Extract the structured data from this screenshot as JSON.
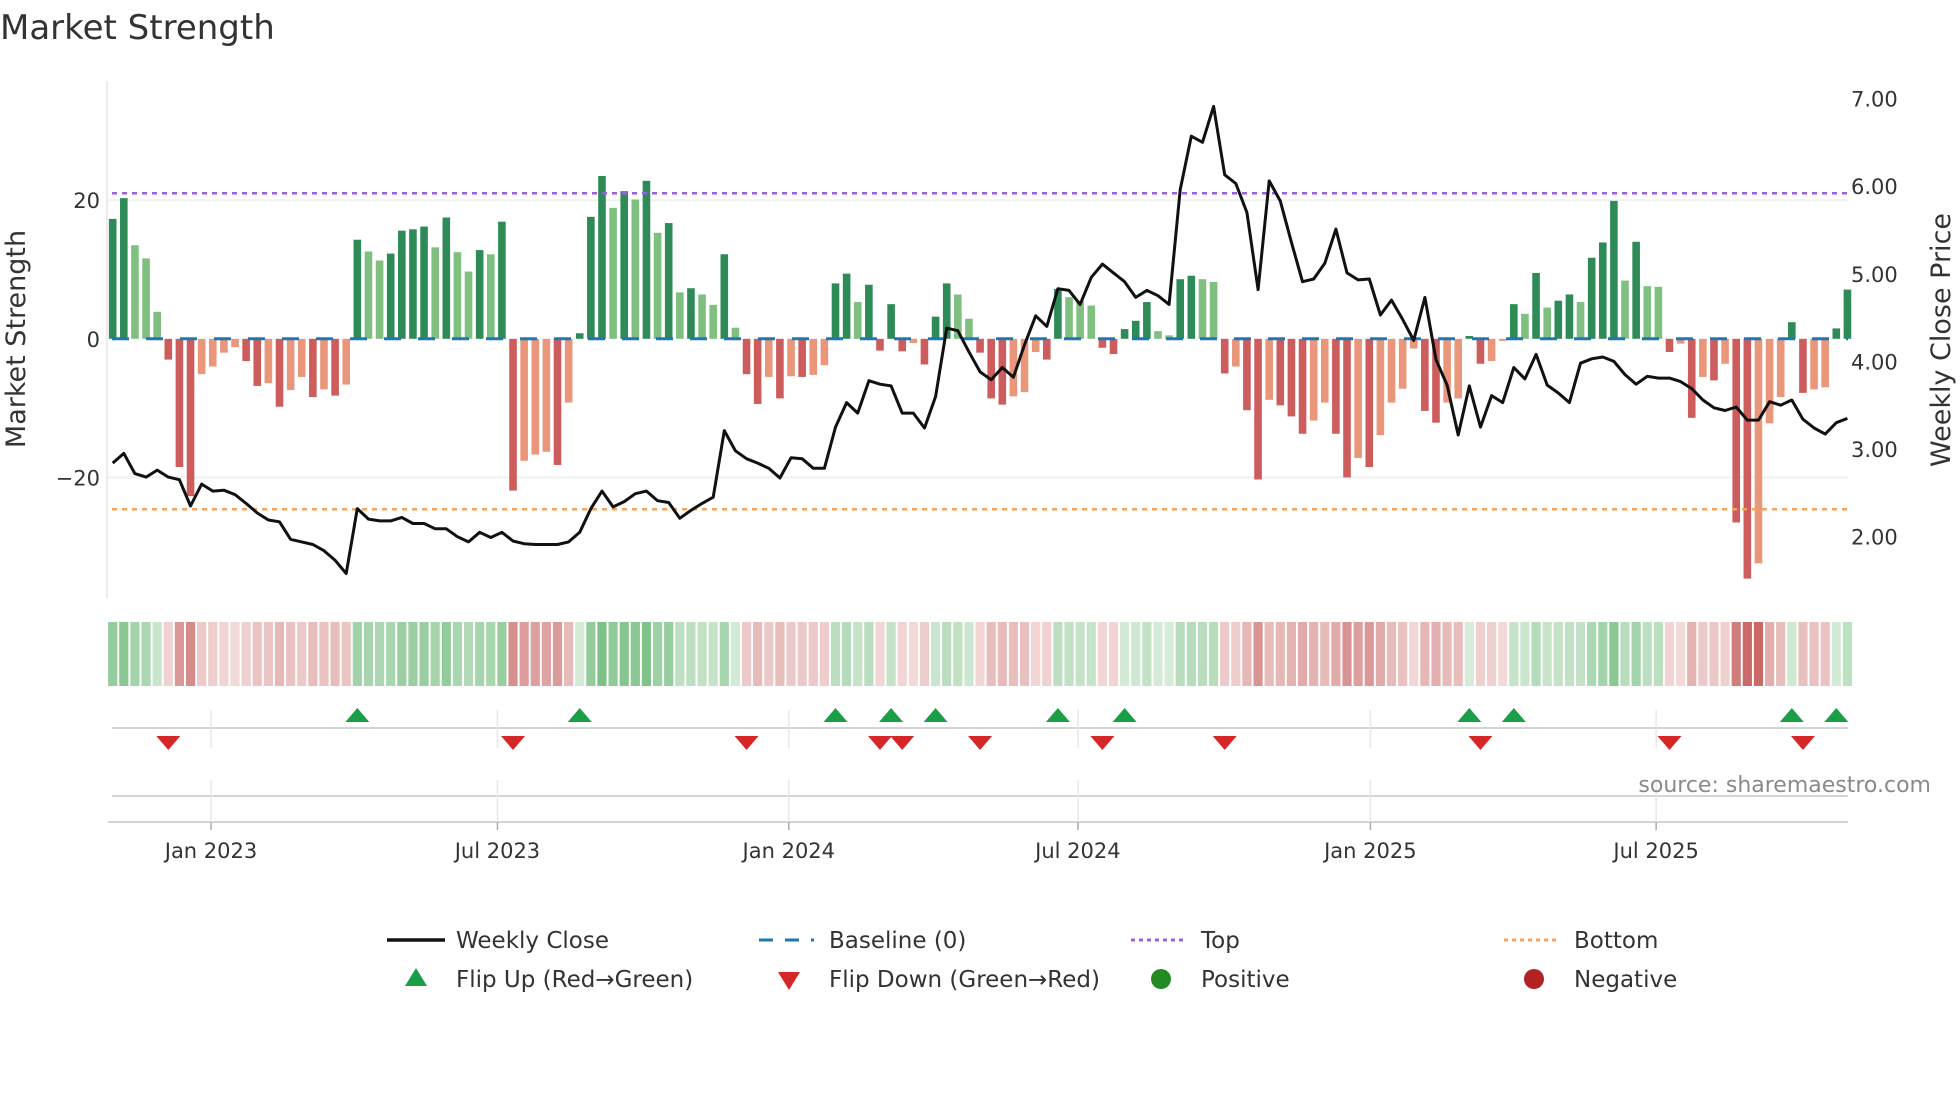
{
  "title": "Market Strength",
  "source": "source: sharemaestro.com",
  "colors": {
    "pos_dark": "#2e8b57",
    "pos_light": "#7fbf7f",
    "neg_dark": "#cd5c5c",
    "neg_light": "#e9967a",
    "baseline": "#1f77b4",
    "top": "#9b5fe0",
    "bottom": "#f4a460",
    "close": "#111111",
    "flip_up": "#1a9e47",
    "flip_down": "#d62728",
    "positive": "#228b22",
    "negative": "#b22222"
  },
  "legend": {
    "weekly_close": "Weekly Close",
    "baseline": "Baseline (0)",
    "top": "Top",
    "bottom": "Bottom",
    "flip_up": "Flip Up (Red→Green)",
    "flip_down": "Flip Down (Green→Red)",
    "positive": "Positive",
    "negative": "Negative"
  },
  "chart_data": {
    "type": "bar",
    "title": "Market Strength",
    "ylabel": "Market Strength",
    "y2label": "Weekly Close Price",
    "ylim": [
      -37.4,
      37.2
    ],
    "y2lim": [
      1.3,
      7.2
    ],
    "yticks": [
      {
        "v": 20,
        "label": "20"
      },
      {
        "v": 0,
        "label": "0"
      },
      {
        "v": -20,
        "label": "−20"
      }
    ],
    "y2ticks": [
      {
        "v": 7,
        "label": "7.00"
      },
      {
        "v": 6,
        "label": "6.00"
      },
      {
        "v": 5,
        "label": "5.00"
      },
      {
        "v": 4,
        "label": "4.00"
      },
      {
        "v": 3,
        "label": "3.00"
      },
      {
        "v": 2,
        "label": "2.00"
      }
    ],
    "xticks": [
      {
        "week": 9.84,
        "label": "Jan 2023"
      },
      {
        "week": 35.6,
        "label": "Jul 2023"
      },
      {
        "week": 61.8,
        "label": "Jan 2024"
      },
      {
        "week": 87.8,
        "label": "Jul 2024"
      },
      {
        "week": 114.1,
        "label": "Jan 2025"
      },
      {
        "week": 139.8,
        "label": "Jul 2025"
      }
    ],
    "top_level": 21.0,
    "bottom_level": -24.6,
    "baseline": 0,
    "strength": [
      17.3,
      20.3,
      13.5,
      11.6,
      3.9,
      -3.0,
      -18.5,
      -22.7,
      -5.1,
      -4.0,
      -2.0,
      -1.2,
      -3.2,
      -6.8,
      -6.4,
      -9.8,
      -7.4,
      -5.5,
      -8.4,
      -7.3,
      -8.2,
      -6.6,
      14.3,
      12.6,
      11.3,
      12.3,
      15.6,
      15.8,
      16.2,
      13.2,
      17.5,
      12.5,
      9.7,
      12.8,
      12.2,
      16.9,
      -21.9,
      -17.6,
      -16.7,
      -16.3,
      -18.2,
      -9.2,
      0.8,
      17.6,
      23.5,
      18.9,
      21.3,
      20.1,
      22.8,
      15.3,
      16.7,
      6.7,
      7.3,
      6.4,
      4.9,
      12.2,
      1.6,
      -5.1,
      -9.4,
      -5.5,
      -8.6,
      -5.4,
      -5.5,
      -5.2,
      -3.8,
      8.0,
      9.4,
      5.3,
      7.8,
      -1.7,
      5.0,
      -1.8,
      -0.6,
      -3.7,
      3.2,
      8.0,
      6.4,
      2.9,
      -2.0,
      -8.6,
      -9.5,
      -8.3,
      -7.7,
      -1.9,
      -3.0,
      7.2,
      6.0,
      5.5,
      4.8,
      -1.3,
      -2.2,
      1.4,
      2.6,
      5.3,
      1.1,
      0.5,
      8.6,
      9.1,
      8.6,
      8.2,
      -5.0,
      -4.0,
      -10.3,
      -20.3,
      -8.8,
      -9.6,
      -11.2,
      -13.7,
      -11.8,
      -9.2,
      -13.7,
      -20.0,
      -17.2,
      -18.5,
      -13.9,
      -9.2,
      -7.2,
      -1.4,
      -10.4,
      -12.1,
      -9.2,
      -8.6,
      0.4,
      -3.6,
      -3.2,
      -0.3,
      5.0,
      3.6,
      9.5,
      4.5,
      5.5,
      6.4,
      5.3,
      11.7,
      13.9,
      19.9,
      8.4,
      14.0,
      7.6,
      7.5,
      -1.9,
      -0.7,
      -11.4,
      -5.5,
      -6.0,
      -3.6,
      -26.5,
      -34.6,
      -32.4,
      -12.2,
      -8.4,
      2.4,
      -7.8,
      -7.3,
      -7.0,
      1.5,
      7.1
    ],
    "close": [
      2.84,
      2.95,
      2.72,
      2.68,
      2.76,
      2.68,
      2.65,
      2.35,
      2.6,
      2.52,
      2.53,
      2.48,
      2.38,
      2.27,
      2.19,
      2.17,
      1.97,
      1.94,
      1.91,
      1.84,
      1.73,
      1.58,
      2.32,
      2.2,
      2.18,
      2.18,
      2.22,
      2.15,
      2.15,
      2.09,
      2.09,
      2.0,
      1.94,
      2.05,
      1.99,
      2.05,
      1.95,
      1.92,
      1.91,
      1.91,
      1.91,
      1.94,
      2.05,
      2.32,
      2.52,
      2.34,
      2.4,
      2.49,
      2.52,
      2.41,
      2.39,
      2.21,
      2.3,
      2.38,
      2.45,
      3.21,
      2.98,
      2.89,
      2.84,
      2.78,
      2.67,
      2.9,
      2.89,
      2.78,
      2.78,
      3.25,
      3.53,
      3.41,
      3.78,
      3.74,
      3.72,
      3.41,
      3.41,
      3.24,
      3.6,
      4.38,
      4.35,
      4.11,
      3.88,
      3.79,
      3.93,
      3.82,
      4.19,
      4.52,
      4.4,
      4.83,
      4.81,
      4.65,
      4.96,
      5.11,
      5.01,
      4.91,
      4.73,
      4.81,
      4.75,
      4.65,
      5.96,
      6.57,
      6.5,
      6.91,
      6.13,
      6.03,
      5.7,
      4.82,
      6.06,
      5.83,
      5.36,
      4.91,
      4.94,
      5.12,
      5.51,
      5.01,
      4.93,
      4.94,
      4.53,
      4.7,
      4.48,
      4.24,
      4.73,
      4.02,
      3.73,
      3.16,
      3.72,
      3.25,
      3.61,
      3.53,
      3.93,
      3.8,
      4.08,
      3.73,
      3.64,
      3.53,
      3.98,
      4.03,
      4.05,
      4.0,
      3.85,
      3.74,
      3.83,
      3.81,
      3.81,
      3.77,
      3.69,
      3.56,
      3.47,
      3.44,
      3.48,
      3.33,
      3.33,
      3.54,
      3.5,
      3.56,
      3.34,
      3.24,
      3.17,
      3.3,
      3.35
    ],
    "shades": [
      "d",
      "d",
      "l",
      "l",
      "l",
      "d",
      "d",
      "d",
      "l",
      "l",
      "l",
      "l",
      "d",
      "d",
      "l",
      "d",
      "l",
      "l",
      "d",
      "l",
      "d",
      "l",
      "d",
      "l",
      "l",
      "d",
      "d",
      "d",
      "d",
      "l",
      "d",
      "l",
      "l",
      "d",
      "l",
      "d",
      "d",
      "l",
      "l",
      "l",
      "d",
      "l",
      "d",
      "d",
      "d",
      "l",
      "d",
      "l",
      "d",
      "l",
      "d",
      "l",
      "d",
      "l",
      "l",
      "d",
      "l",
      "d",
      "d",
      "l",
      "d",
      "l",
      "d",
      "l",
      "l",
      "d",
      "d",
      "l",
      "d",
      "d",
      "d",
      "d",
      "l",
      "d",
      "d",
      "d",
      "l",
      "l",
      "d",
      "d",
      "d",
      "l",
      "l",
      "l",
      "d",
      "d",
      "l",
      "l",
      "l",
      "d",
      "d",
      "d",
      "d",
      "d",
      "l",
      "l",
      "d",
      "d",
      "l",
      "l",
      "d",
      "l",
      "d",
      "d",
      "l",
      "d",
      "d",
      "d",
      "l",
      "l",
      "d",
      "d",
      "l",
      "d",
      "l",
      "l",
      "l",
      "l",
      "d",
      "d",
      "l",
      "l",
      "d",
      "d",
      "l",
      "l",
      "d",
      "l",
      "d",
      "l",
      "d",
      "d",
      "l",
      "d",
      "d",
      "d",
      "l",
      "d",
      "l",
      "l",
      "d",
      "l",
      "d",
      "l",
      "d",
      "l",
      "d",
      "d",
      "l",
      "l",
      "l",
      "d",
      "d",
      "l",
      "l",
      "d",
      "d"
    ]
  }
}
